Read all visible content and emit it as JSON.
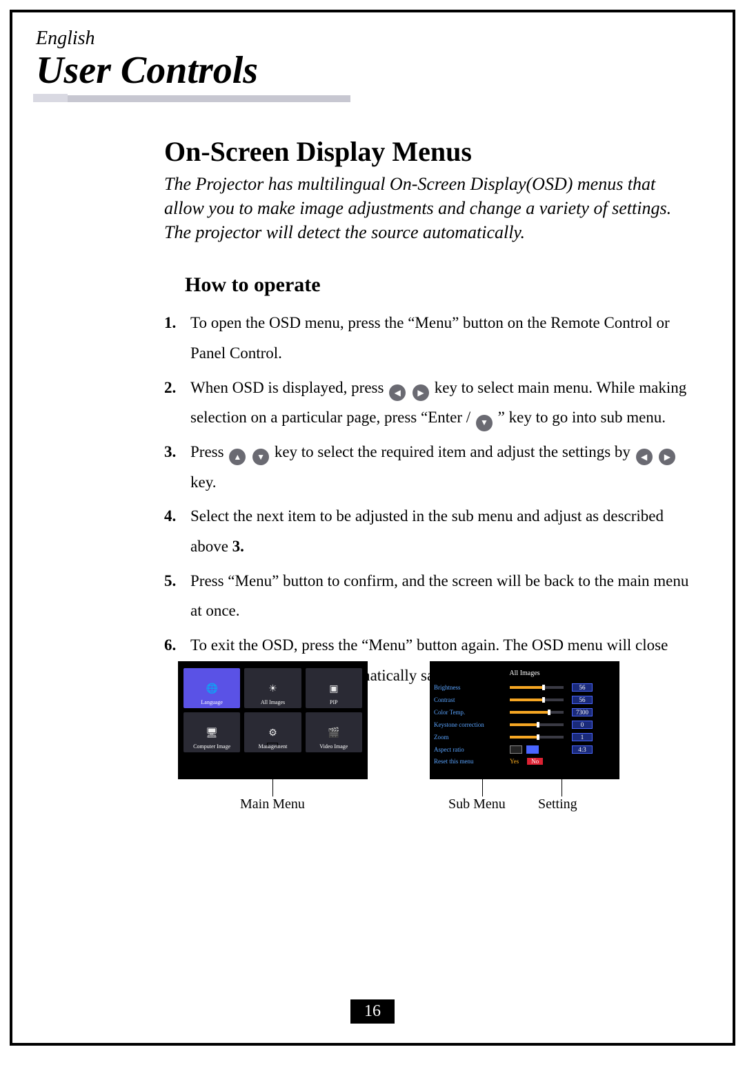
{
  "lang_label": "English",
  "title": "User Controls",
  "section_heading": "On-Screen Display Menus",
  "intro": "The Projector has multilingual On-Screen Display(OSD) menus that allow you to make image adjustments and change a variety of settings. The projector will detect the source automatically.",
  "howto_heading": "How to operate",
  "steps": {
    "s1_num": "1.",
    "s1": "To open the OSD menu, press the “Menu” button on the Remote Control or Panel Control.",
    "s2_num": "2.",
    "s2_a": "When OSD is displayed, press ",
    "s2_b": " key to select main menu. While making selection on a particular page, press “Enter / ",
    "s2_c": "” key to go into sub menu.",
    "s3_num": "3.",
    "s3_a": "Press ",
    "s3_b": " key to select the required item and adjust the settings by ",
    "s3_c": " key.",
    "s4_num": "4.",
    "s4_a": "Select the next item to be adjusted in the sub menu and adjust as described above ",
    "s4_b": "3.",
    "s5_num": "5.",
    "s5": "Press “Menu” button to confirm, and the screen will be back to the main menu at once.",
    "s6_num": "6.",
    "s6": "To exit the OSD, press the “Menu” button again. The OSD menu will close and the projector will automatically save the new settings."
  },
  "osd_main": {
    "tiles": {
      "t0": "Language",
      "t1": "All Images",
      "t2": "PIP",
      "t3": "Computer Image",
      "t4": "Management",
      "t5": "Video Image"
    }
  },
  "osd_sub": {
    "title": "All Images",
    "rows": {
      "brightness": {
        "label": "Brightness",
        "value": "56"
      },
      "contrast": {
        "label": "Contrast",
        "value": "56"
      },
      "colortemp": {
        "label": "Color Temp.",
        "value": "7300"
      },
      "keystone": {
        "label": "Keystone correction",
        "value": "0"
      },
      "zoom": {
        "label": "Zoom",
        "value": "1"
      },
      "aspect": {
        "label": "Aspect ratio",
        "value": "4:3"
      },
      "reset": {
        "label": "Reset this menu",
        "yes": "Yes",
        "no": "No"
      }
    }
  },
  "captions": {
    "main": "Main Menu",
    "sub": "Sub Menu",
    "setting": "Setting"
  },
  "page_number": "16"
}
